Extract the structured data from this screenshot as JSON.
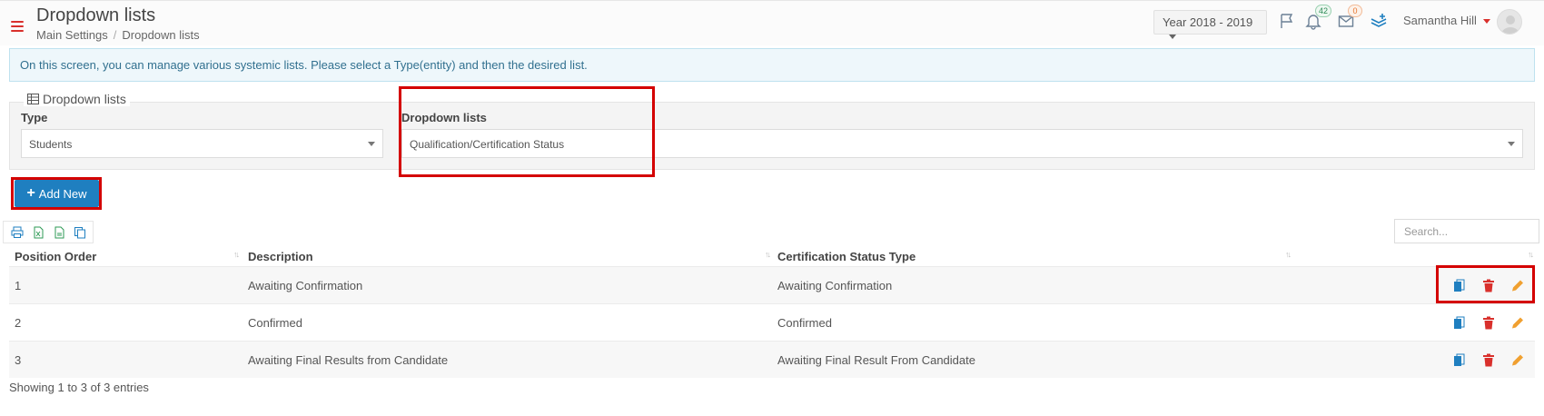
{
  "header": {
    "title": "Dropdown lists",
    "breadcrumb": [
      "Main Settings",
      "Dropdown lists"
    ],
    "year": "Year 2018 - 2019",
    "notifications_count": "42",
    "messages_count": "0",
    "user_name": "Samantha Hill"
  },
  "info_note": "On this screen, you can manage various systemic lists. Please select a Type(entity) and then the desired list.",
  "filter": {
    "legend": "Dropdown lists",
    "type_label": "Type",
    "type_value": "Students",
    "list_label": "Dropdown lists",
    "list_value": "Qualification/Certification Status"
  },
  "add_button": "Add New",
  "search_placeholder": "Search...",
  "table": {
    "columns": [
      "Position Order",
      "Description",
      "Certification Status Type"
    ],
    "rows": [
      {
        "order": "1",
        "description": "Awaiting Confirmation",
        "status": "Awaiting Confirmation"
      },
      {
        "order": "2",
        "description": "Confirmed",
        "status": "Confirmed"
      },
      {
        "order": "3",
        "description": "Awaiting Final Results from Candidate",
        "status": "Awaiting Final Result From Candidate"
      }
    ]
  },
  "footer_text": "Showing 1 to 3 of 3 entries",
  "colors": {
    "accent": "#1f7fc0",
    "highlight": "#d40000",
    "delete": "#d9302c",
    "edit": "#f0a030"
  }
}
